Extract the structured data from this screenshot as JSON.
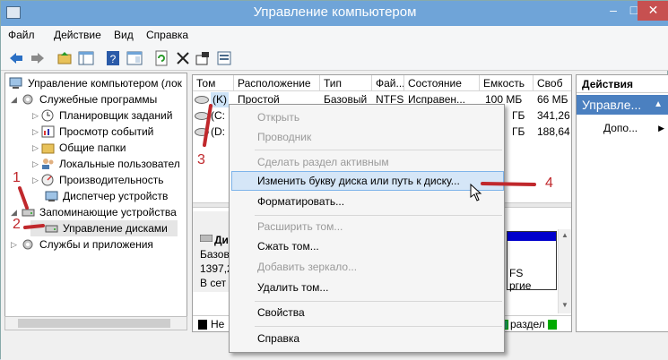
{
  "window": {
    "title": "Управление компьютером",
    "min": "–",
    "max": "□",
    "close": "✕"
  },
  "menu": [
    "Файл",
    "Действие",
    "Вид",
    "Справка"
  ],
  "toolbar_icons": [
    "back-arrow-icon",
    "forward-arrow-icon",
    "up-folder-icon",
    "show-tree-icon",
    "help-icon",
    "console-icon",
    "refresh-icon",
    "delete-icon",
    "properties-icon",
    "export-icon"
  ],
  "tree": [
    {
      "label": "Управление компьютером (лок"
    },
    {
      "label": "Служебные программы"
    },
    {
      "label": "Планировщик заданий"
    },
    {
      "label": "Просмотр событий"
    },
    {
      "label": "Общие папки"
    },
    {
      "label": "Локальные пользовател"
    },
    {
      "label": "Производительность"
    },
    {
      "label": "Диспетчер устройств"
    },
    {
      "label": "Запоминающие устройства"
    },
    {
      "label": "Управление дисками"
    },
    {
      "label": "Службы и приложения"
    }
  ],
  "columns": [
    "Том",
    "Расположение",
    "Тип",
    "Фай...",
    "Состояние",
    "Емкость",
    "Своб"
  ],
  "volumes": [
    {
      "name": "(K)",
      "layout": "Простой",
      "type": "Базовый",
      "fs": "NTFS",
      "status": "Исправен...",
      "capacity": "100 МБ",
      "free": "66 МБ"
    },
    {
      "name": "(C:",
      "capacity": "ГБ",
      "free": "341,26"
    },
    {
      "name": "(D:",
      "capacity": "ГБ",
      "free": "188,64"
    }
  ],
  "disk_panel": {
    "disk_label": "Ди",
    "basic": "Базов",
    "size": "1397,2",
    "online": "В сет",
    "fs": "FS",
    "health": "ргие"
  },
  "legend": {
    "unallocated": "Не",
    "primary": "раздел"
  },
  "actions": {
    "header": "Действия",
    "selected": "Управле...",
    "more": "Допо..."
  },
  "context_menu": [
    {
      "label": "Открыть",
      "enabled": false
    },
    {
      "label": "Проводник",
      "enabled": false
    },
    {
      "label": "Сделать раздел активным",
      "enabled": false
    },
    {
      "label": "Изменить букву диска или путь к диску...",
      "enabled": true
    },
    {
      "label": "Форматировать...",
      "enabled": true
    },
    {
      "label": "Расширить том...",
      "enabled": false
    },
    {
      "label": "Сжать том...",
      "enabled": true
    },
    {
      "label": "Добавить зеркало...",
      "enabled": false
    },
    {
      "label": "Удалить том...",
      "enabled": true
    },
    {
      "label": "Свойства",
      "enabled": true
    },
    {
      "label": "Справка",
      "enabled": true
    }
  ],
  "annotations": [
    "1",
    "2",
    "3",
    "4"
  ],
  "colors": {
    "annotation": "#c0282c",
    "highlight": "#d5e6f7",
    "titlebar": "#6fa4d8",
    "volume_bar": "#0000cc",
    "primary_green": "#00aa00"
  }
}
